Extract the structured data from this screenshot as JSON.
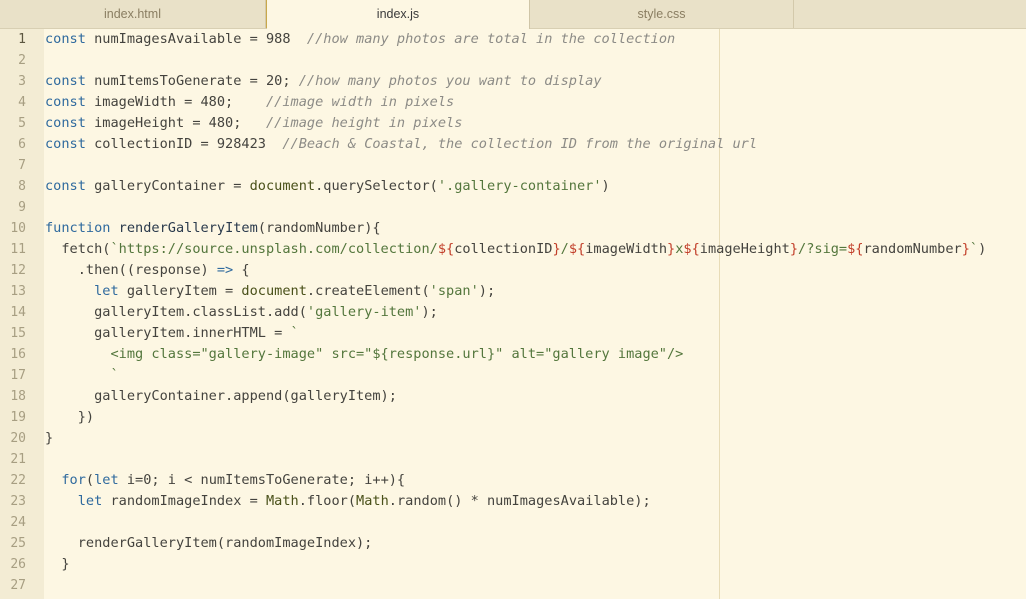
{
  "tabs": [
    {
      "label": "index.html",
      "active": false
    },
    {
      "label": "index.js",
      "active": true
    },
    {
      "label": "style.css",
      "active": false
    }
  ],
  "current_line": 1,
  "line_numbers": [
    "1",
    "2",
    "3",
    "4",
    "5",
    "6",
    "7",
    "8",
    "9",
    "10",
    "11",
    "12",
    "13",
    "14",
    "15",
    "16",
    "17",
    "18",
    "19",
    "20",
    "21",
    "22",
    "23",
    "24",
    "25",
    "26",
    "27"
  ],
  "code_lines": [
    [
      [
        "k",
        "const "
      ],
      [
        "n",
        "numImagesAvailable = 988  "
      ],
      [
        "c",
        "//how many photos are total in the collection"
      ]
    ],
    [],
    [
      [
        "k",
        "const "
      ],
      [
        "n",
        "numItemsToGenerate = 20; "
      ],
      [
        "c",
        "//how many photos you want to display"
      ]
    ],
    [
      [
        "k",
        "const "
      ],
      [
        "n",
        "imageWidth = 480;    "
      ],
      [
        "c",
        "//image width in pixels"
      ]
    ],
    [
      [
        "k",
        "const "
      ],
      [
        "n",
        "imageHeight = 480;   "
      ],
      [
        "c",
        "//image height in pixels"
      ]
    ],
    [
      [
        "k",
        "const "
      ],
      [
        "n",
        "collectionID = 928423  "
      ],
      [
        "c",
        "//Beach & Coastal, the collection ID from the original url"
      ]
    ],
    [],
    [
      [
        "k",
        "const "
      ],
      [
        "n",
        "galleryContainer = "
      ],
      [
        "f",
        "document"
      ],
      [
        "n",
        ".querySelector("
      ],
      [
        "s",
        "'.gallery-container'"
      ],
      [
        "n",
        ")"
      ]
    ],
    [],
    [
      [
        "k",
        "function "
      ],
      [
        "fn",
        "renderGalleryItem"
      ],
      [
        "n",
        "(randomNumber){"
      ]
    ],
    [
      [
        "n",
        "  fetch("
      ],
      [
        "s",
        "`https://source.unsplash.com/collection/"
      ],
      [
        "t",
        "${"
      ],
      [
        "n",
        "collectionID"
      ],
      [
        "t",
        "}"
      ],
      [
        "s",
        "/"
      ],
      [
        "t",
        "${"
      ],
      [
        "n",
        "imageWidth"
      ],
      [
        "t",
        "}"
      ],
      [
        "s",
        "x"
      ],
      [
        "t",
        "${"
      ],
      [
        "n",
        "imageHeight"
      ],
      [
        "t",
        "}"
      ],
      [
        "s",
        "/?sig="
      ],
      [
        "t",
        "${"
      ],
      [
        "n",
        "randomNumber"
      ],
      [
        "t",
        "}"
      ],
      [
        "s",
        "`"
      ],
      [
        "n",
        ")"
      ]
    ],
    [
      [
        "n",
        "    .then((response) "
      ],
      [
        "k",
        "=>"
      ],
      [
        "n",
        " {"
      ]
    ],
    [
      [
        "k",
        "      let "
      ],
      [
        "n",
        "galleryItem = "
      ],
      [
        "f",
        "document"
      ],
      [
        "n",
        ".createElement("
      ],
      [
        "s",
        "'span'"
      ],
      [
        "n",
        ");"
      ]
    ],
    [
      [
        "n",
        "      galleryItem.classList.add("
      ],
      [
        "s",
        "'gallery-item'"
      ],
      [
        "n",
        ");"
      ]
    ],
    [
      [
        "n",
        "      galleryItem.innerHTML = "
      ],
      [
        "s",
        "`"
      ]
    ],
    [
      [
        "s",
        "        <img class=\"gallery-image\" src=\"${response.url}\" alt=\"gallery image\"/>"
      ]
    ],
    [
      [
        "s",
        "        `"
      ]
    ],
    [
      [
        "n",
        "      galleryContainer.append(galleryItem);"
      ]
    ],
    [
      [
        "n",
        "    })"
      ]
    ],
    [
      [
        "n",
        "}"
      ]
    ],
    [],
    [
      [
        "k",
        "  for"
      ],
      [
        "n",
        "("
      ],
      [
        "k",
        "let "
      ],
      [
        "n",
        "i=0; i < numItemsToGenerate; i++){"
      ]
    ],
    [
      [
        "k",
        "    let "
      ],
      [
        "n",
        "randomImageIndex = "
      ],
      [
        "f",
        "Math"
      ],
      [
        "n",
        ".floor("
      ],
      [
        "f",
        "Math"
      ],
      [
        "n",
        ".random() * numImagesAvailable);"
      ]
    ],
    [],
    [
      [
        "n",
        "    renderGalleryItem(randomImageIndex);"
      ]
    ],
    [
      [
        "n",
        "  }"
      ]
    ],
    []
  ]
}
